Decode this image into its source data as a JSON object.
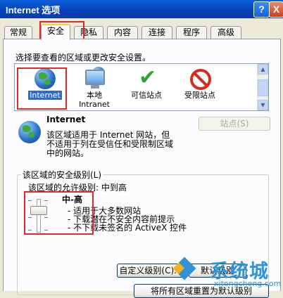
{
  "window": {
    "title": "Internet 选项",
    "help_button": "?",
    "close_button": "X"
  },
  "tabs": [
    {
      "label": "常规",
      "active": false
    },
    {
      "label": "安全",
      "active": true
    },
    {
      "label": "隐私",
      "active": false
    },
    {
      "label": "内容",
      "active": false
    },
    {
      "label": "连接",
      "active": false
    },
    {
      "label": "程序",
      "active": false
    },
    {
      "label": "高级",
      "active": false
    }
  ],
  "security": {
    "instruction": "选择要查看的区域或更改安全设置。",
    "zones": [
      {
        "label": "Internet",
        "icon": "globe-icon",
        "selected": true
      },
      {
        "label": "本地\nIntranet",
        "icon": "intranet-computer-icon",
        "selected": false
      },
      {
        "label": "可信站点",
        "icon": "green-check-icon",
        "selected": false
      },
      {
        "label": "受限站点",
        "icon": "no-entry-icon",
        "selected": false
      }
    ],
    "selected_zone": {
      "name": "Internet",
      "description_lines": [
        "该区域适用于 Internet 网站，但",
        "不适用于列在受信任和受限制区域",
        "中的网站。"
      ],
      "sites_button": "站点(S)"
    },
    "level_group": {
      "legend": "该区域的安全级别(L)",
      "allowed_levels": "该区域的允许级别: 中到高",
      "level_name": "中-高",
      "level_points": [
        "- 适用于大多数网站",
        "- 下载潜在不安全内容前提示",
        "- 不下载未签名的 ActiveX 控件"
      ],
      "custom_level_button": "自定义级别(C)...",
      "default_level_button_partial": "默认级别",
      "reset_all_button_partial": "将所有区域重置为默认级别"
    }
  },
  "watermark": {
    "brand": "系统城",
    "url": "xitongcheng.com"
  },
  "colors": {
    "titlebar": "#0a5fd8",
    "active_tab_accent": "#ffc83c",
    "annotation_red": "#e0282a",
    "selection_blue": "#316ac5",
    "watermark_blue": "#2f93d6"
  }
}
